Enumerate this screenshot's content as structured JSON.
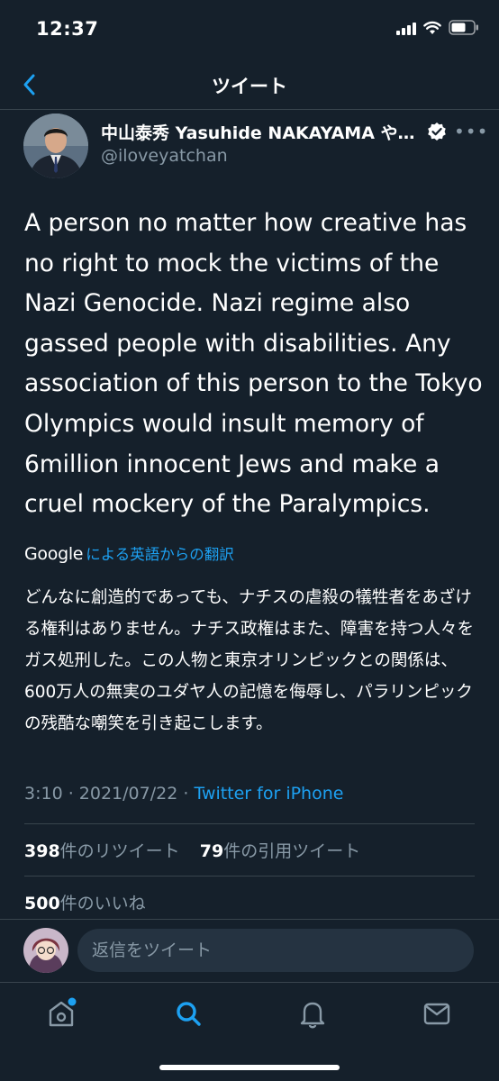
{
  "status_bar": {
    "time": "12:37"
  },
  "nav": {
    "title": "ツイート"
  },
  "tweet": {
    "author": {
      "display_name": "中山泰秀 Yasuhide NAKAYAMA や…",
      "handle": "@iloveyatchan",
      "verified": true
    },
    "text": "A person no matter how creative has no right to mock the victims of the Nazi Genocide. Nazi regime also gassed people with disabilities. Any association of this person to the Tokyo Olympics would insult memory of 6million innocent Jews and make a cruel mockery of the Paralympics.",
    "translation": {
      "provider": "Google",
      "link_text": "による英語からの翻訳",
      "text": "どんなに創造的であっても、ナチスの虐殺の犠牲者をあざける権利はありません。ナチス政権はまた、障害を持つ人々をガス処刑した。この人物と東京オリンピックとの関係は、600万人の無実のユダヤ人の記憶を侮辱し、パラリンピックの残酷な嘲笑を引き起こします。"
    },
    "meta": {
      "time": "3:10",
      "separator": " · ",
      "date": "2021/07/22",
      "source": "Twitter for iPhone"
    },
    "stats": {
      "retweets_count": "398",
      "retweets_label": "件のリツイート",
      "quotes_count": "79",
      "quotes_label": "件の引用ツイート",
      "likes_count": "500",
      "likes_label": "件のいいね"
    }
  },
  "reply": {
    "placeholder": "返信をツイート"
  },
  "tab_bar": {
    "items": [
      {
        "icon": "home-icon",
        "badge": true
      },
      {
        "icon": "search-icon",
        "active": true
      },
      {
        "icon": "notifications-icon"
      },
      {
        "icon": "messages-icon"
      }
    ]
  },
  "colors": {
    "background": "#15202b",
    "accent": "#1da1f2",
    "secondary_text": "#8899a6",
    "divider": "#38444d"
  }
}
